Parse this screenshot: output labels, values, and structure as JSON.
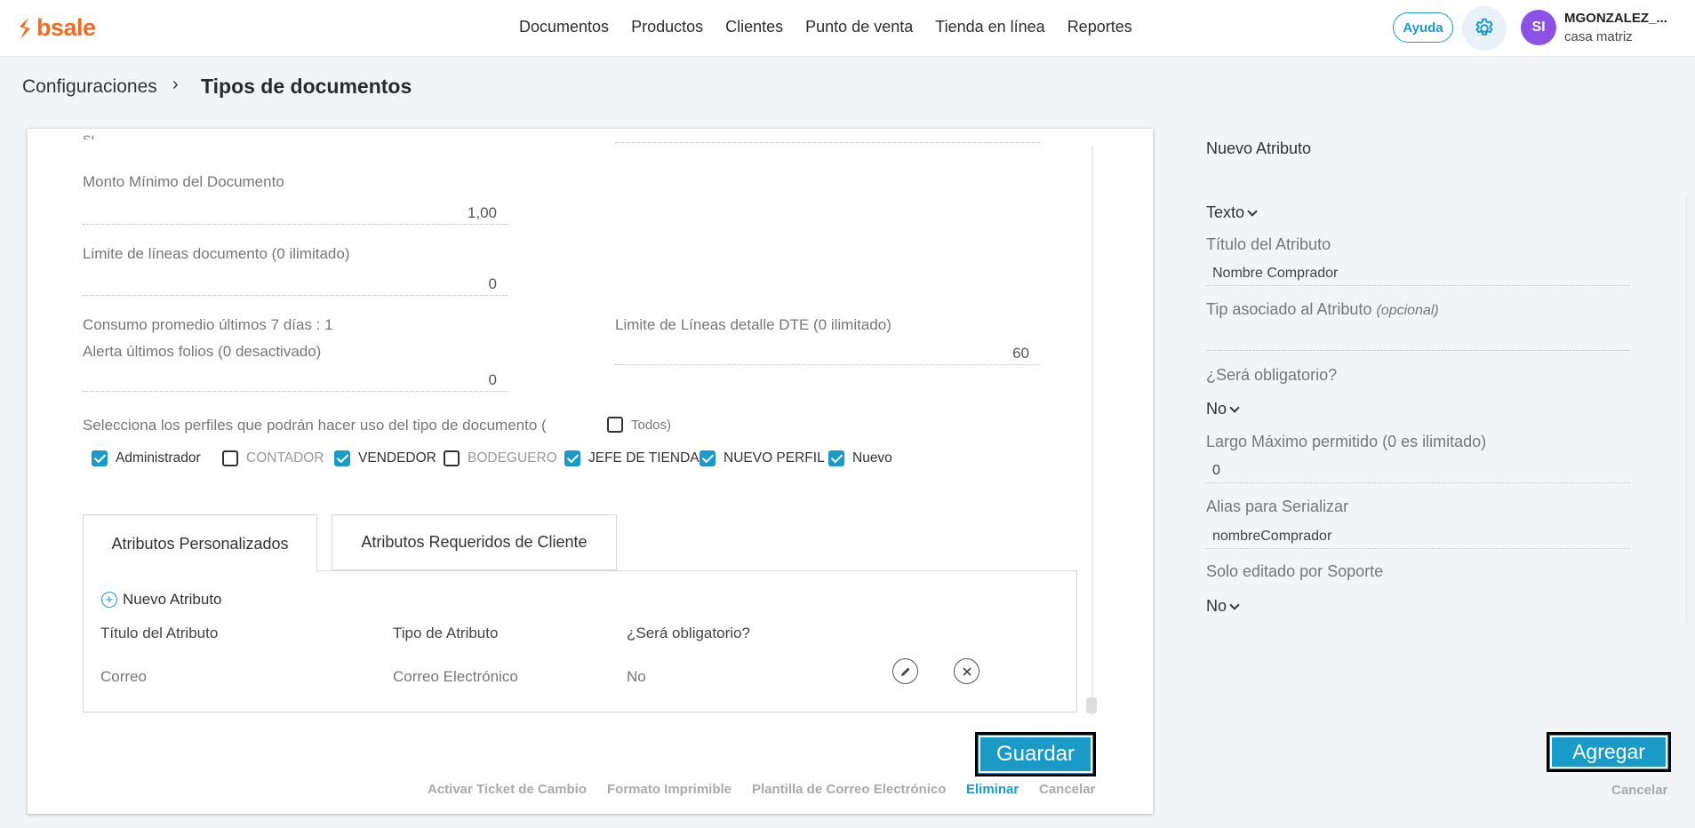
{
  "brand": {
    "logo_text": "bsale",
    "accent": "#f26b21",
    "primary": "#1a9bc7"
  },
  "nav": [
    "Documentos",
    "Productos",
    "Clientes",
    "Punto de venta",
    "Tienda en línea",
    "Reportes"
  ],
  "header": {
    "help": "Ayuda",
    "avatar_initials": "SI",
    "user_name": "MGONZALEZ_...",
    "branch": "casa matriz"
  },
  "breadcrumb": {
    "root": "Configuraciones",
    "sep": "›",
    "title": "Tipos de documentos"
  },
  "form": {
    "cut_label": "SI",
    "min_amount": {
      "label": "Monto Mínimo del Documento",
      "value": "1,00"
    },
    "line_limit": {
      "label": "Limite de líneas documento (0 ilimitado)",
      "value": "0"
    },
    "avg_consumption": "Consumo promedio últimos 7 días : 1",
    "folio_alert": {
      "label": "Alerta últimos folios (0 desactivado)",
      "value": "0"
    },
    "dte_limit": {
      "label": "Limite de Líneas detalle DTE (0 ilimitado)",
      "value": "60"
    },
    "profiles_label": "Selecciona los perfiles que podrán hacer uso del tipo de documento (",
    "all_label": "Todos)",
    "profiles": [
      {
        "label": "Administrador",
        "checked": true
      },
      {
        "label": "CONTADOR",
        "checked": false
      },
      {
        "label": "VENDEDOR",
        "checked": true
      },
      {
        "label": "BODEGUERO",
        "checked": false
      },
      {
        "label": "JEFE DE TIENDA",
        "checked": true
      },
      {
        "label": "NUEVO PERFIL",
        "checked": true
      },
      {
        "label": "Nuevo",
        "checked": true
      }
    ]
  },
  "tabs": [
    "Atributos Personalizados",
    "Atributos Requeridos de Cliente"
  ],
  "attributes": {
    "new_label": "Nuevo Atributo",
    "headers": [
      "Título del Atributo",
      "Tipo de Atributo",
      "¿Será obligatorio?"
    ],
    "rows": [
      {
        "title": "Correo",
        "type": "Correo Electrónico",
        "required": "No"
      }
    ]
  },
  "actions": {
    "save": "Guardar",
    "links": [
      "Activar Ticket de Cambio",
      "Formato Imprimible",
      "Plantilla de Correo Electrónico",
      "Eliminar",
      "Cancelar"
    ]
  },
  "panel": {
    "title": "Nuevo Atributo",
    "type": "Texto",
    "attr_title_label": "Título del Atributo",
    "attr_title_value": "Nombre Comprador",
    "tip_label": "Tip asociado al Atributo",
    "tip_optional": "(opcional)",
    "tip_value": "",
    "required_label": "¿Será obligatorio?",
    "required_value": "No",
    "max_len_label": "Largo Máximo permitido (0 es ilimitado)",
    "max_len_value": "0",
    "alias_label": "Alias para Serializar",
    "alias_value": "nombreComprador",
    "support_label": "Solo editado por Soporte",
    "support_value": "No",
    "add": "Agregar",
    "cancel": "Cancelar"
  }
}
